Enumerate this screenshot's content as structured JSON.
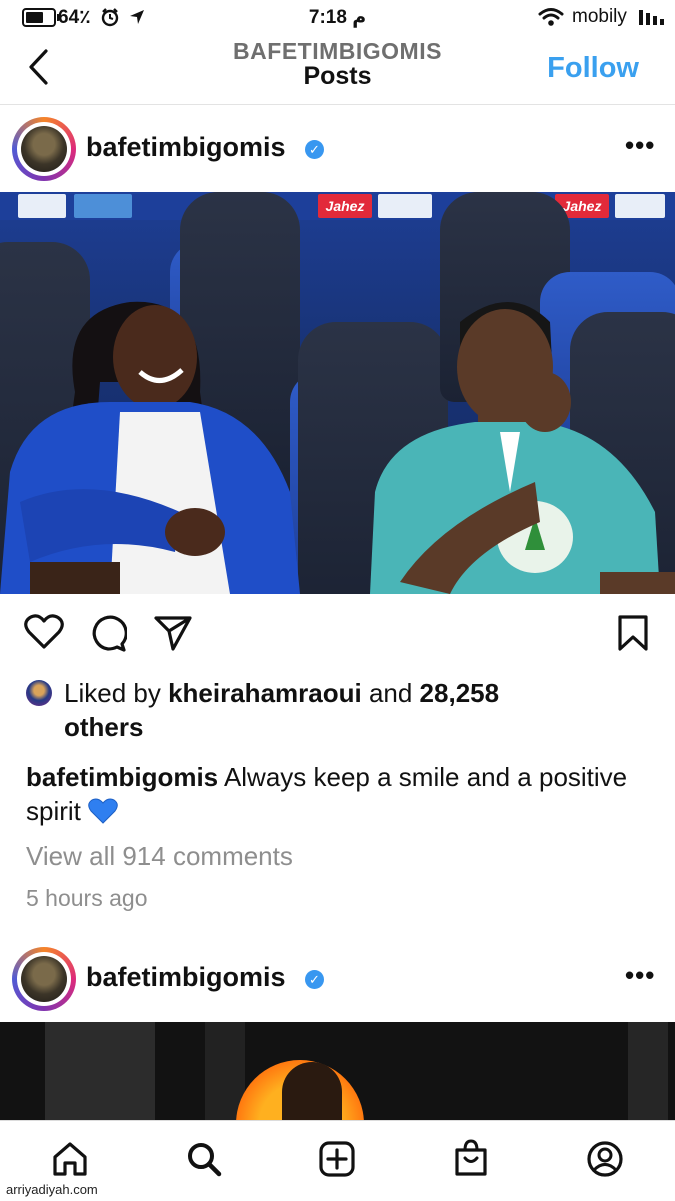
{
  "status_bar": {
    "battery": "64٪",
    "time": "7:18 م",
    "carrier": "mobily"
  },
  "header": {
    "account": "BAFETIMBIGOMIS",
    "title": "Posts",
    "follow_label": "Follow"
  },
  "post1": {
    "username": "bafetimbigomis",
    "liked_prefix": "Liked by ",
    "liked_user": "kheirahamraoui",
    "liked_and": " and ",
    "liked_count": "28,258",
    "liked_suffix": "others",
    "caption_user": "bafetimbigomis",
    "caption_text": "Always keep a smile and a positive spirit",
    "view_comments": "View all 914 comments",
    "time_ago": "5 hours ago"
  },
  "post2": {
    "username": "bafetimbigomis"
  },
  "photo1_ads": [
    "Jahez",
    "Jahez"
  ],
  "tabbar": [
    "home-icon",
    "search-icon",
    "add-post-icon",
    "shop-icon",
    "profile-icon"
  ],
  "watermark": "arriyadiyah.com",
  "colors": {
    "follow": "#3aa0ef",
    "verified": "#3897f0",
    "muted_text": "#8e8e8e",
    "heart_emoji": "#2f7ff0"
  }
}
